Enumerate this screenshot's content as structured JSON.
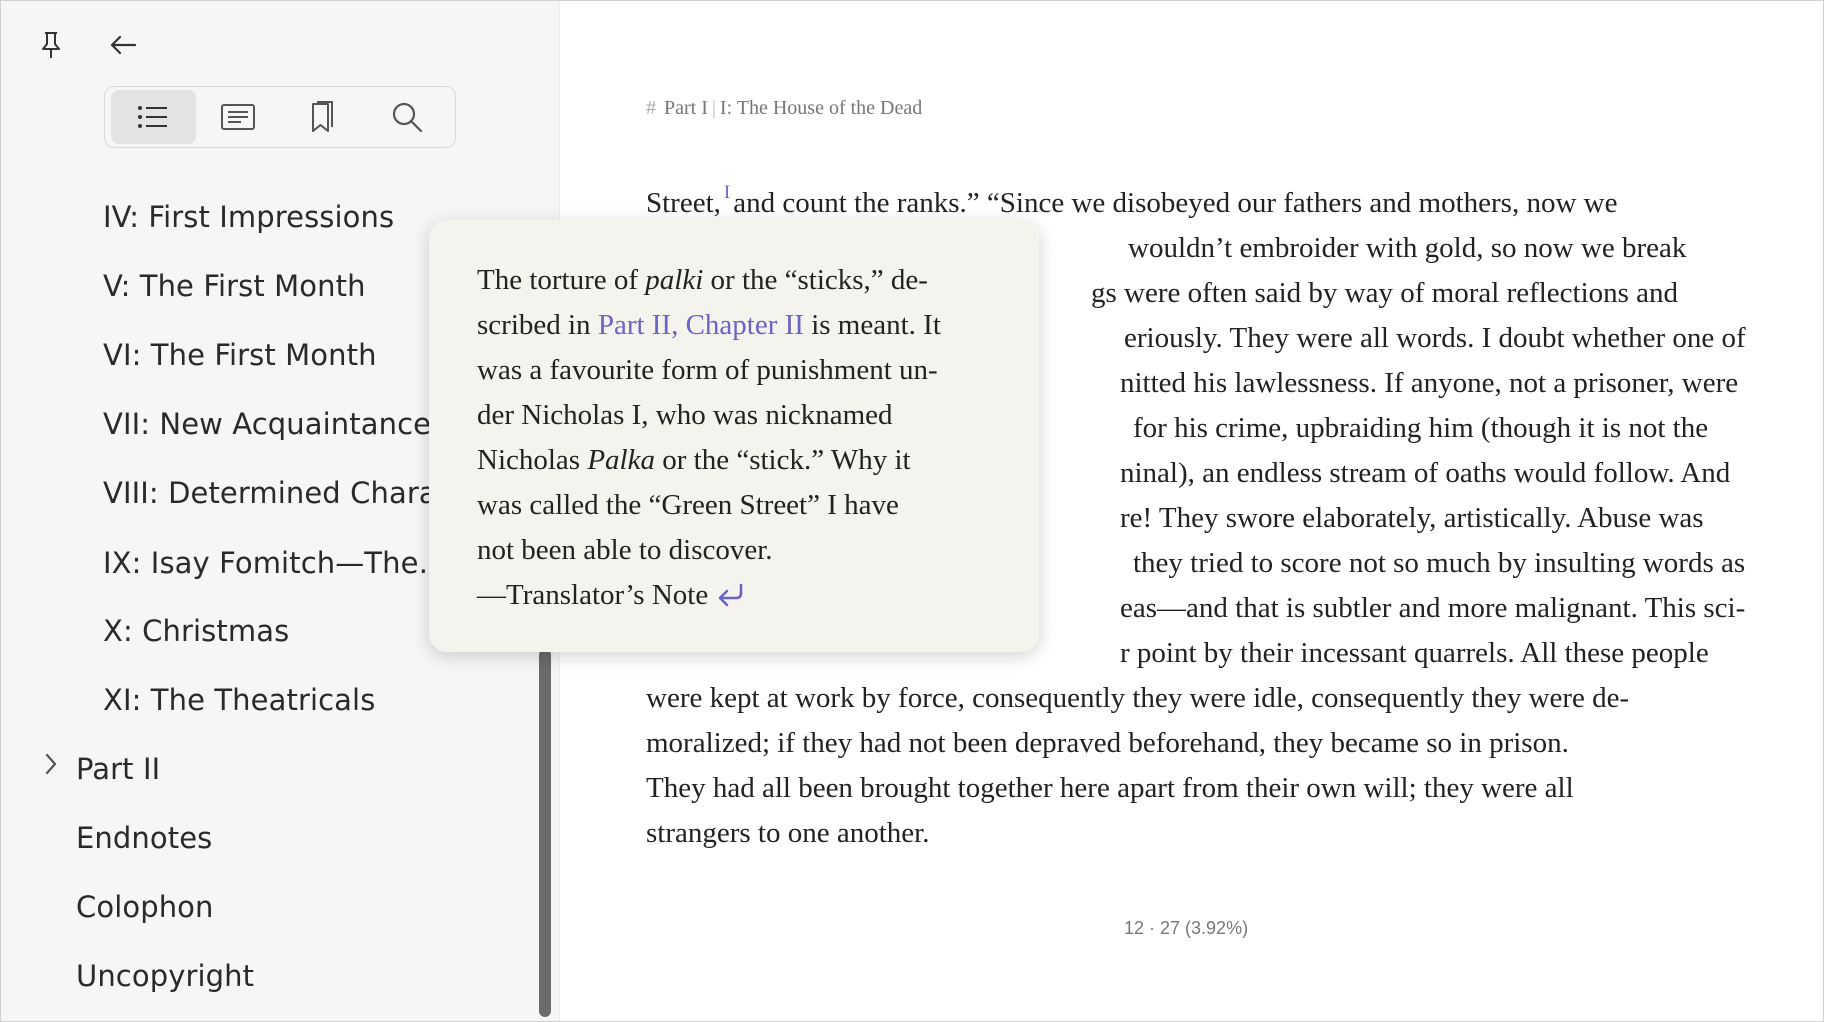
{
  "sidebar": {
    "tabs": [
      {
        "name": "contents",
        "icon": "list-icon",
        "active": true
      },
      {
        "name": "notes",
        "icon": "notes-icon",
        "active": false
      },
      {
        "name": "bookmarks",
        "icon": "bookmark-icon",
        "active": false
      },
      {
        "name": "search",
        "icon": "search-icon",
        "active": false
      }
    ],
    "toc": [
      {
        "label": "IV: First Impressions"
      },
      {
        "label": "V: The First Month"
      },
      {
        "label": "VI: The First Month"
      },
      {
        "label": "VII: New Acquaintances…"
      },
      {
        "label": "VIII: Determined Characte"
      },
      {
        "label": "IX: Isay Fomitch—The…"
      },
      {
        "label": "X: Christmas"
      },
      {
        "label": "XI: The Theatricals"
      },
      {
        "label": "Part II"
      },
      {
        "label": "Endnotes"
      },
      {
        "label": "Colophon"
      },
      {
        "label": "Uncopyright"
      }
    ]
  },
  "reader": {
    "breadcrumb": {
      "hash": "#",
      "part": "Part I",
      "sep": "|",
      "chapter": "I: The House of the Dead"
    },
    "noteref": "I",
    "lines": [
      "and count the ranks.” “Since we disobeyed our fathers and mothers, now we",
      "wouldn’t embroider with gold, so now we break",
      "gs were often said by way of moral reflections and",
      "eriously. They were all words. I doubt whether one of",
      "nitted his lawlessness. If anyone, not a prisoner, were",
      "for his crime, upbraiding him (though it is not the",
      "ninal), an endless stream of oaths would follow. And",
      "re! They swore elaborately, artistically. Abuse was",
      "they tried to score not so much by insulting words as",
      "eas—and that is subtler and more malignant. This sci-",
      "r point by their incessant quarrels. All these people",
      "were kept at work by force, consequently they were idle, consequently they were de-",
      "moralized; if they had not been depraved beforehand, they became so in prison.",
      "They had all been brought together here apart from their own will; they were all",
      "strangers to one another."
    ],
    "first_word": "Street,",
    "pager": "12 · 27   (3.92%)"
  },
  "popup": {
    "l1a": "The torture of ",
    "l1i": "palki",
    "l1b": " or the “sticks,” de-",
    "l2a": "scribed in ",
    "l2link": "Part II, Chapter II",
    "l2b": " is meant. It",
    "l3": "was a favourite form of punishment un-",
    "l4": "der Nicholas I, who was nicknamed",
    "l5a": "Nicholas ",
    "l5i": "Palka",
    "l5b": " or the “stick.” Why it",
    "l6": "was called the “Green Street” I have",
    "l7": "not been able to discover.",
    "l8": "—Translator’s Note"
  }
}
